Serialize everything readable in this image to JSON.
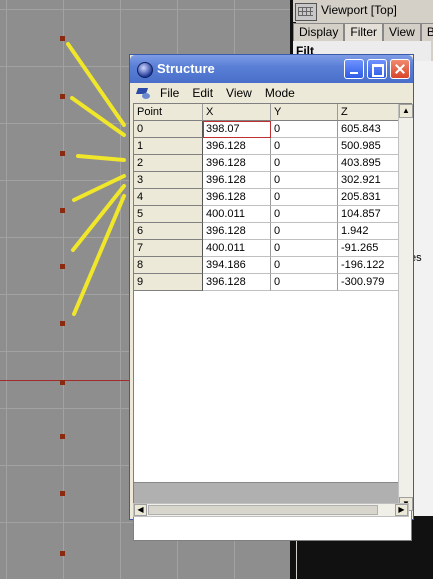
{
  "viewport": {
    "title": "Viewport [Top]",
    "tabs": [
      "Display",
      "Filter",
      "View",
      "B"
    ],
    "active_tab": "Filter",
    "sub_label": "Filt",
    "fragment_text": "es"
  },
  "structure": {
    "title": "Structure",
    "menu": [
      "File",
      "Edit",
      "View",
      "Mode"
    ],
    "columns": [
      "Point",
      "X",
      "Y",
      "Z"
    ],
    "rows": [
      [
        "0",
        "398.07",
        "0",
        "605.843"
      ],
      [
        "1",
        "396.128",
        "0",
        "500.985"
      ],
      [
        "2",
        "396.128",
        "0",
        "403.895"
      ],
      [
        "3",
        "396.128",
        "0",
        "302.921"
      ],
      [
        "4",
        "396.128",
        "0",
        "205.831"
      ],
      [
        "5",
        "400.011",
        "0",
        "104.857"
      ],
      [
        "6",
        "396.128",
        "0",
        "1.942"
      ],
      [
        "7",
        "400.011",
        "0",
        "-91.265"
      ],
      [
        "8",
        "394.186",
        "0",
        "-196.122"
      ],
      [
        "9",
        "396.128",
        "0",
        "-300.979"
      ]
    ]
  },
  "colors": {
    "accent_spark": "#f0e62a",
    "selection_outline": "#c03030",
    "titlebar": "#4a6fca"
  }
}
